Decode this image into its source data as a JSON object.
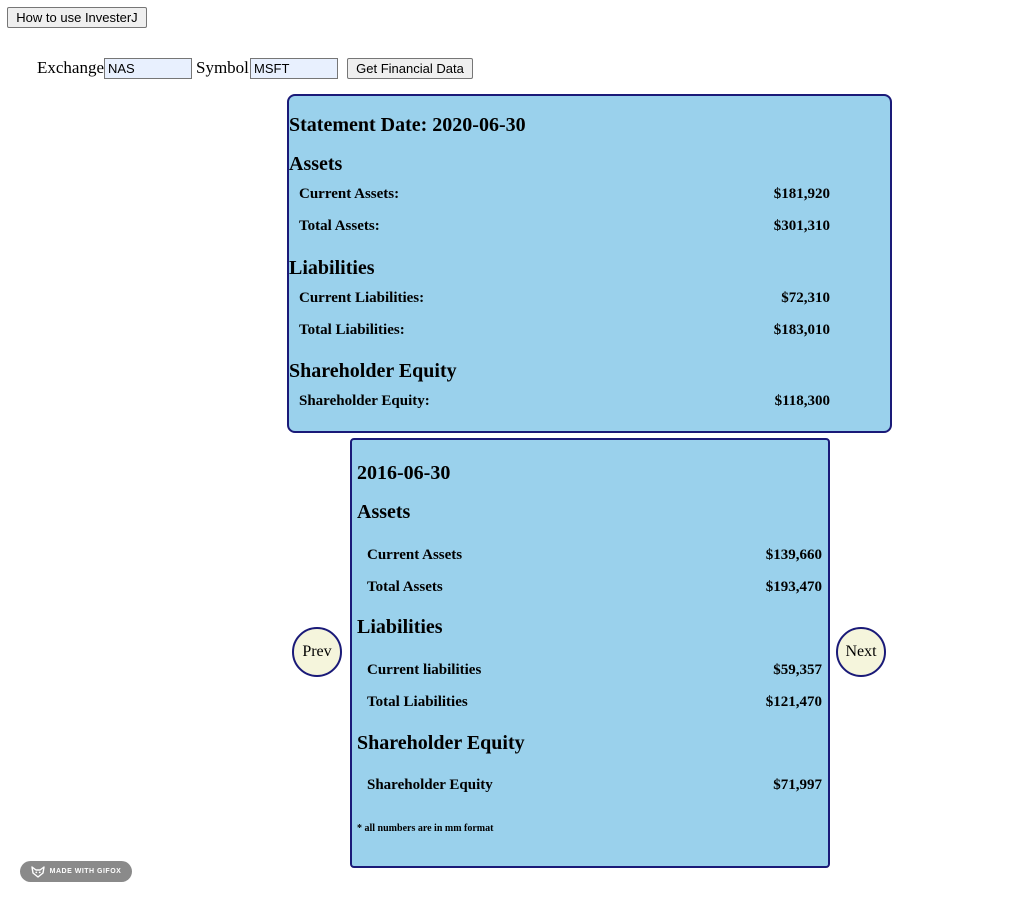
{
  "header": {
    "howto_label": "How to use InvesterJ",
    "exchange_label": "Exchange",
    "exchange_value": "NAS",
    "symbol_label": "Symbol",
    "symbol_value": "MSFT",
    "get_data_label": "Get Financial Data"
  },
  "current": {
    "title": "Statement Date: 2020-06-30",
    "assets_heading": "Assets",
    "current_assets_label": "Current Assets:",
    "current_assets_value": "$181,920",
    "total_assets_label": "Total Assets:",
    "total_assets_value": "$301,310",
    "liabilities_heading": "Liabilities",
    "current_liabilities_label": "Current Liabilities:",
    "current_liabilities_value": "$72,310",
    "total_liabilities_label": "Total Liabilities:",
    "total_liabilities_value": "$183,010",
    "equity_heading": "Shareholder Equity",
    "equity_label": "Shareholder Equity:",
    "equity_value": "$118,300"
  },
  "historical": {
    "title": "2016-06-30",
    "assets_heading": "Assets",
    "current_assets_label": "Current Assets",
    "current_assets_value": "$139,660",
    "total_assets_label": "Total Assets",
    "total_assets_value": "$193,470",
    "liabilities_heading": "Liabilities",
    "current_liabilities_label": "Current liabilities",
    "current_liabilities_value": "$59,357",
    "total_liabilities_label": "Total Liabilities",
    "total_liabilities_value": "$121,470",
    "equity_heading": "Shareholder Equity",
    "equity_label": "Shareholder Equity",
    "equity_value": "$71,997",
    "footnote": "* all numbers are in mm format"
  },
  "nav": {
    "prev_label": "Prev",
    "next_label": "Next"
  },
  "badge": {
    "label": "MADE WITH GIFOX",
    "icon": "fox-icon"
  },
  "colors": {
    "card_bg": "#9ad1ec",
    "card_border": "#1a1a78",
    "nav_bg": "#f5f5dc"
  }
}
